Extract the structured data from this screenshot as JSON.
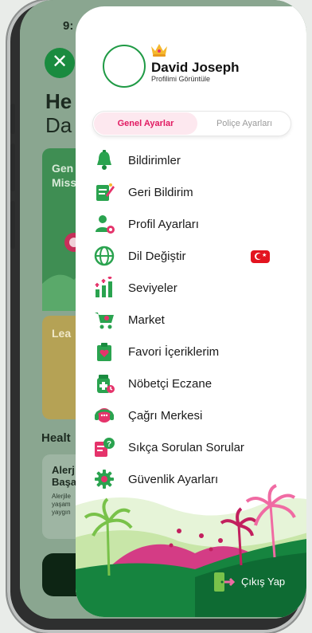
{
  "background_app": {
    "time": "9:",
    "close_icon": "close-icon",
    "title_line1": "He",
    "title_line2": "Da",
    "card1_text": "Gen\nMiss",
    "card2_text": "Lea",
    "section_title": "Healt",
    "card3_title": "Alerj\nBaşa",
    "card3_body": "Alerjile\nyaşam\nyaygın"
  },
  "profile": {
    "crown_icon": "crown-icon",
    "name": "David Joseph",
    "subtitle": "Profilimi Görüntüle"
  },
  "segment": {
    "active_label": "Genel Ayarlar",
    "inactive_label": "Poliçe Ayarları"
  },
  "menu": {
    "items": [
      {
        "label": "Bildirimler",
        "icon": "bell-icon"
      },
      {
        "label": "Geri Bildirim",
        "icon": "feedback-icon"
      },
      {
        "label": "Profil Ayarları",
        "icon": "profile-settings-icon"
      },
      {
        "label": "Dil Değiştir",
        "icon": "globe-icon"
      },
      {
        "label": "Seviyeler",
        "icon": "levels-icon"
      },
      {
        "label": "Market",
        "icon": "cart-icon"
      },
      {
        "label": "Favori İçeriklerim",
        "icon": "favorite-icon"
      },
      {
        "label": "Nöbetçi Eczane",
        "icon": "pharmacy-icon"
      },
      {
        "label": "Çağrı Merkesi",
        "icon": "headset-icon"
      },
      {
        "label": "Sıkça Sorulan Sorular",
        "icon": "faq-icon"
      },
      {
        "label": "Güvenlik Ayarları",
        "icon": "security-gear-icon"
      }
    ],
    "language_flag": "turkey-flag-icon"
  },
  "logout": {
    "label": "Çıkış Yap",
    "icon": "logout-icon"
  },
  "colors": {
    "brand_green": "#1f9a45",
    "accent_pink": "#e11a61",
    "dark_green": "#0e6b33"
  }
}
